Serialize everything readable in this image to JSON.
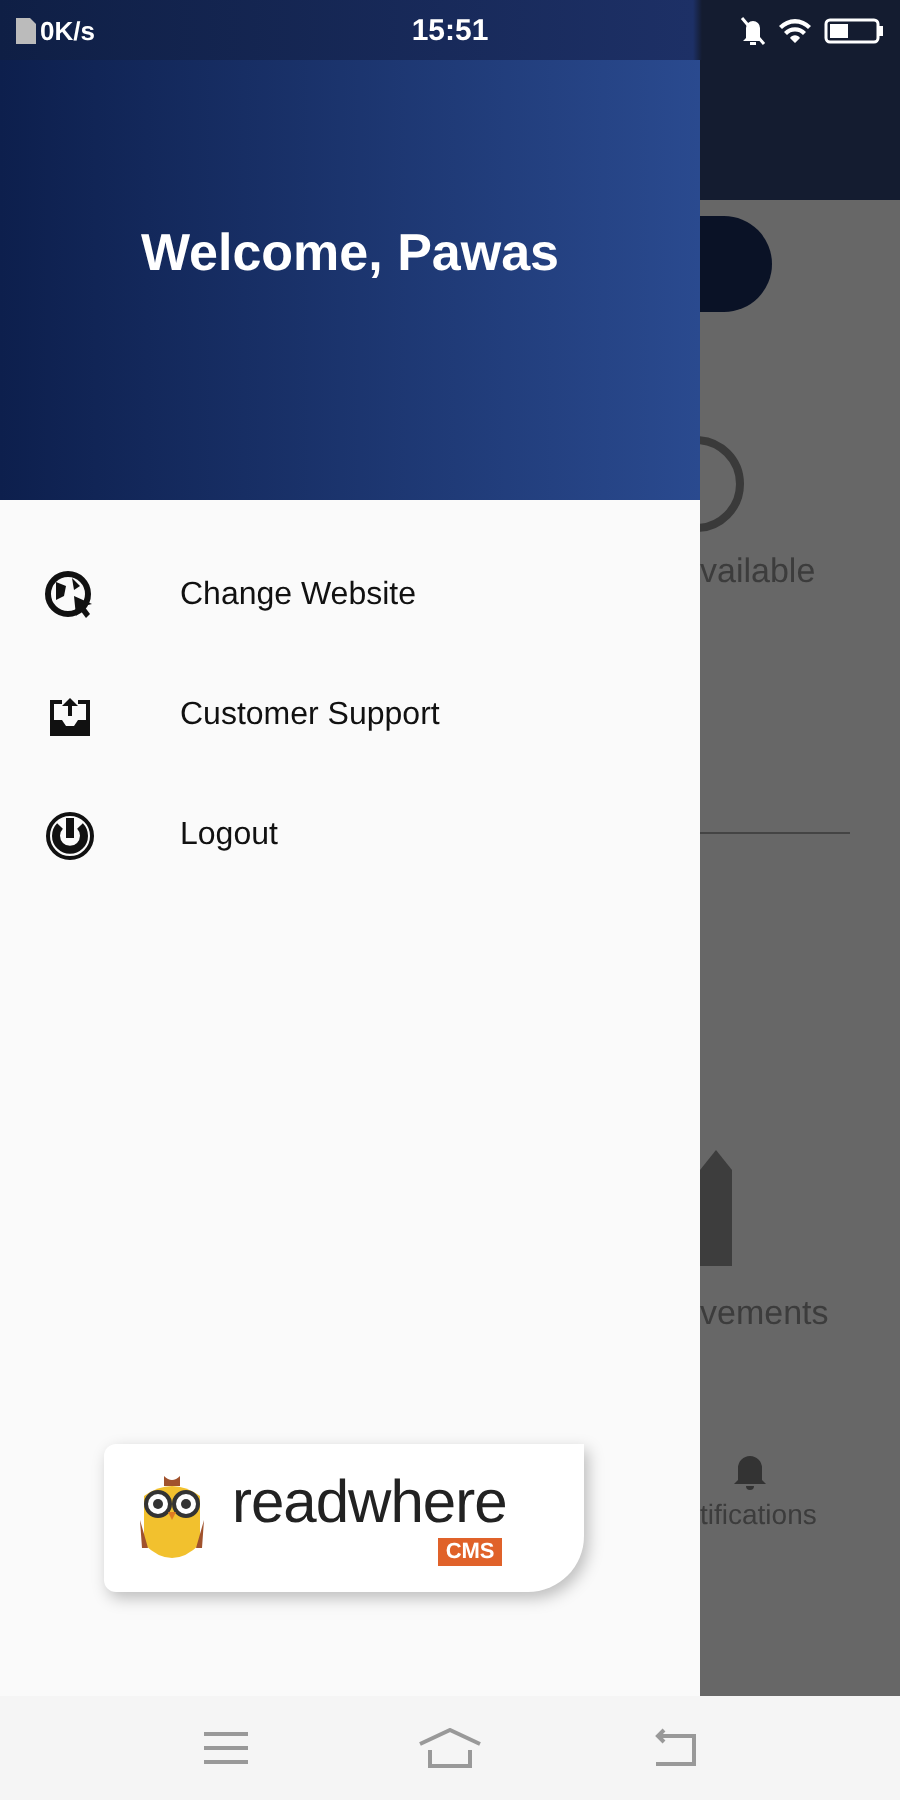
{
  "status_bar": {
    "speed": "0K/s",
    "time": "15:51"
  },
  "drawer": {
    "welcome": "Welcome, Pawas",
    "items": [
      {
        "kind": "website",
        "label": "Change Website"
      },
      {
        "kind": "support",
        "label": "Customer Support"
      },
      {
        "kind": "logout",
        "label": "Logout"
      }
    ],
    "logo": {
      "name": "readwhere",
      "badge": "CMS"
    }
  },
  "background_app": {
    "texts": [
      "vailable",
      "vements"
    ],
    "nav_label": "tifications"
  }
}
